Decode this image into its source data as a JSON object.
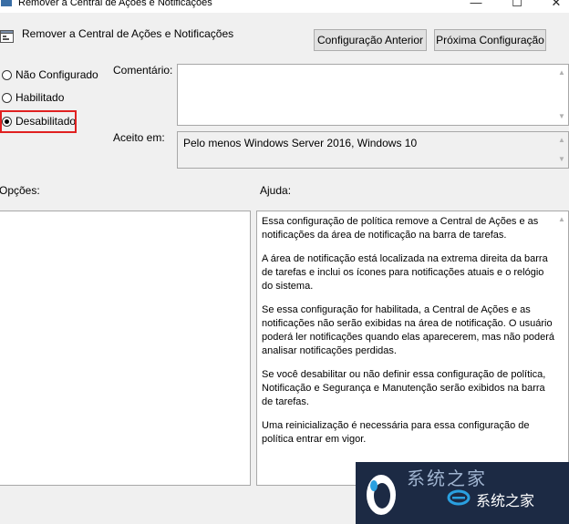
{
  "window": {
    "title": "Remover a Central de Ações e Notificações",
    "minimize_glyph": "—",
    "maximize_glyph": "☐",
    "close_glyph": "✕"
  },
  "header": {
    "policy_title": "Remover a Central de Ações e Notificações",
    "prev_button": "Configuração Anterior",
    "next_button": "Próxima Configuração"
  },
  "state": {
    "options": [
      {
        "label": "Não Configurado",
        "selected": false
      },
      {
        "label": "Habilitado",
        "selected": false
      },
      {
        "label": "Desabilitado",
        "selected": true
      }
    ]
  },
  "comment": {
    "label": "Comentário:",
    "value": ""
  },
  "supported": {
    "label": "Aceito em:",
    "value": "Pelo menos Windows Server 2016, Windows 10"
  },
  "options_panel": {
    "label": "Opções:"
  },
  "help_panel": {
    "label": "Ajuda:",
    "paragraphs": [
      "Essa configuração de política remove a Central de Ações e as notificações da área de notificação na barra de tarefas.",
      "A área de notificação está localizada na extrema direita da barra de tarefas e inclui os ícones para notificações atuais e o relógio do sistema.",
      "Se essa configuração for habilitada, a Central de Ações e as notificações não serão exibidas na área de notificação. O usuário poderá ler notificações quando elas aparecerem, mas não poderá analisar notificações perdidas.",
      "Se você desabilitar ou não definir essa configuração de política, Notificação e Segurança e Manutenção serão exibidos na barra de tarefas.",
      "Uma reinicialização é necessária para essa configuração de política entrar em vigor."
    ]
  },
  "watermark": {
    "top_text": "系统之家",
    "bottom_text": "系统之家"
  },
  "colors": {
    "highlight": "#e02020",
    "window_bg": "#f0f0f0",
    "watermark_bg": "#1c2a44"
  }
}
